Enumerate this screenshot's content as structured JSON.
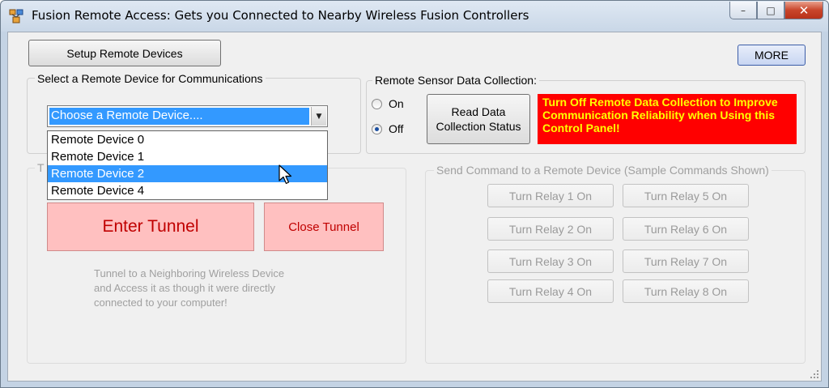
{
  "window": {
    "title": "Fusion Remote Access: Gets you Connected to Nearby Wireless Fusion Controllers",
    "controls": {
      "minimize": "–",
      "maximize": "□",
      "close": "✕"
    }
  },
  "toolbar": {
    "setup_label": "Setup Remote Devices",
    "more_label": "MORE"
  },
  "device_select": {
    "group_label": "Select a Remote Device for Communications",
    "combo_value": "Choose a Remote Device....",
    "options": [
      "Remote Device 0",
      "Remote Device 1",
      "Remote Device 2",
      "Remote Device 4"
    ],
    "highlighted_index": 2
  },
  "sensor": {
    "group_label": "Remote Sensor Data Collection:",
    "on_label": "On",
    "off_label": "Off",
    "selected": "Off",
    "read_status_label": "Read Data Collection Status",
    "warning": "Turn Off Remote Data Collection to Improve Communication Reliability when Using this Control Panel!"
  },
  "tunnel": {
    "group_label": "T",
    "enter_label": "Enter Tunnel",
    "close_label": "Close Tunnel",
    "description": "Tunnel to a Neighboring Wireless Device and Access it as though it were directly connected to your computer!"
  },
  "commands": {
    "group_label": "Send Command to a  Remote Device (Sample Commands Shown)",
    "relays": [
      "Turn Relay 1 On",
      "Turn Relay 5 On",
      "Turn Relay 2 On",
      "Turn Relay 6 On",
      "Turn Relay 3 On",
      "Turn Relay 7 On",
      "Turn Relay 4 On",
      "Turn Relay 8 On"
    ]
  },
  "colors": {
    "warning_bg": "#ff0000",
    "warning_text": "#ffff00",
    "tunnel_bg": "#ffc0c0",
    "tunnel_text": "#c00000",
    "highlight": "#3399ff"
  }
}
